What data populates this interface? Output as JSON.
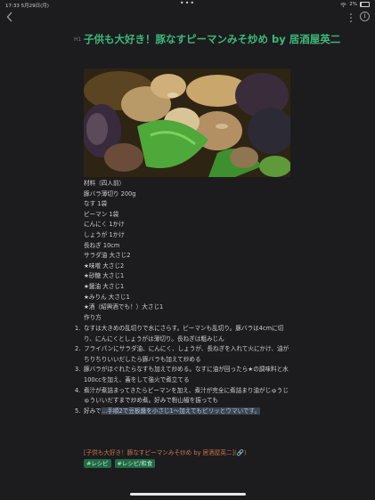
{
  "status_bar": {
    "time": "17:33  5月29日(月)",
    "dots": "•••",
    "battery": "2%"
  },
  "nav": {
    "info_glyph": "i"
  },
  "note": {
    "heading_marker": "H1",
    "title": "子供も大好き！豚なすピーマンみそ炒め by 居酒屋英二",
    "ingredients": [
      "材料（四人前）",
      "豚バラ薄切り 200g",
      "なす 1袋",
      "ピーマン 1袋",
      "にんにく 1かけ",
      "しょうが 1かけ",
      "長ねぎ 10cm",
      "サラダ油 大さじ2",
      "★味噌 大さじ2",
      "★砂糖 大さじ1",
      "★醤油 大さじ1",
      "★みりん 大さじ1",
      "★酒（紹興酒でも！）大さじ1",
      "作り方"
    ],
    "steps": [
      {
        "num": "1.",
        "lines": [
          "なすは大きめの乱切りで水にさらす。ピーマンも乱切り。豚バラは4cmに切",
          "り、にんにくとしょうがは薄切り。長ねぎは粗みじん"
        ]
      },
      {
        "num": "2.",
        "lines": [
          "フライパンにサラダ油、にんにく、しょうが、長ねぎを入れて火にかけ、油が",
          "ちりちりいいだしたら豚バラも加えて炒める"
        ]
      },
      {
        "num": "3.",
        "lines": [
          "豚バラがほぐれたらなすも加えて炒める。なすに油が回ったら★の調味料と水",
          "100ccを加え、蓋をして強火で煮立てる"
        ]
      },
      {
        "num": "4.",
        "lines": [
          "煮汁が煮詰まってきたらピーマンを加え、煮汁が完全に煮詰まり油がじゅうじ",
          "ゅういいだすまで炒め煮。好みで粉山椒を振っても"
        ]
      },
      {
        "num": "5.",
        "prefix": "好みで",
        "highlight": "…手順2で豆板醤を小さじ1〜加えてもピリッとウマいです。"
      }
    ],
    "link_text": "[子供も大好き！豚なすピーマンみそ炒め by 居酒屋英二](",
    "link_icon": "🔗",
    "link_close": ")",
    "tags": [
      "#レシピ",
      "#レシピ/和食"
    ]
  },
  "colors": {
    "title": "#3cb878",
    "tag_bg": "#1f6b45",
    "link": "#c9744e",
    "highlight_bg": "#3b4452"
  }
}
